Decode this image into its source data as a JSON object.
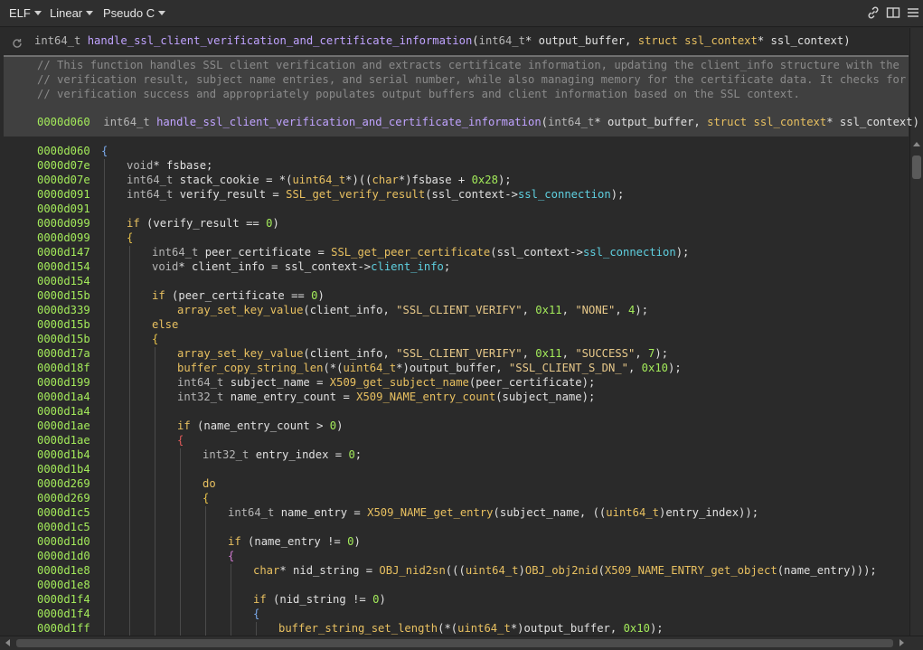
{
  "toolbar": {
    "view_menu": "ELF",
    "layout_menu": "Linear",
    "lang_menu": "Pseudo C",
    "icons": [
      "link-icon",
      "split-view-icon",
      "hamburger-menu-icon"
    ]
  },
  "header_signature": [
    {
      "t": "int64_t ",
      "c": "type"
    },
    {
      "t": "handle_ssl_client_verification_and_certificate_information",
      "c": "fn"
    },
    {
      "t": "(",
      "c": "var"
    },
    {
      "t": "int64_t",
      "c": "type"
    },
    {
      "t": "* output_buffer, ",
      "c": "var"
    },
    {
      "t": "struct ",
      "c": "kw"
    },
    {
      "t": "ssl_context",
      "c": "kw"
    },
    {
      "t": "* ssl_context)",
      "c": "var"
    }
  ],
  "comment_lines": [
    "// This function handles SSL client verification and extracts certificate information, updating the client_info structure with the",
    "// verification result, subject name entries, and serial number, while also managing memory for the certificate data. It checks for",
    "// verification success and appropriately populates output buffers and client information based on the SSL context."
  ],
  "comment_signature": [
    {
      "t": "0000d060  ",
      "c": "num"
    },
    {
      "t": "int64_t ",
      "c": "type"
    },
    {
      "t": "handle_ssl_client_verification_and_certificate_information",
      "c": "fn"
    },
    {
      "t": "(",
      "c": "var"
    },
    {
      "t": "int64_t",
      "c": "type"
    },
    {
      "t": "* output_buffer, ",
      "c": "var"
    },
    {
      "t": "struct ",
      "c": "kw"
    },
    {
      "t": "ssl_context",
      "c": "kw"
    },
    {
      "t": "* ssl_context)",
      "c": "var"
    }
  ],
  "code_lines": [
    {
      "addr": "0000d060",
      "indent": 0,
      "tokens": [
        {
          "t": "{",
          "c": "bl"
        }
      ]
    },
    {
      "addr": "0000d07e",
      "indent": 1,
      "tokens": [
        {
          "t": "void",
          "c": "type"
        },
        {
          "t": "* fsbase;",
          "c": "var"
        }
      ]
    },
    {
      "addr": "0000d07e",
      "indent": 1,
      "tokens": [
        {
          "t": "int64_t",
          "c": "type"
        },
        {
          "t": " stack_cookie = *(",
          "c": "var"
        },
        {
          "t": "uint64_t",
          "c": "kw"
        },
        {
          "t": "*)((",
          "c": "var"
        },
        {
          "t": "char",
          "c": "kw"
        },
        {
          "t": "*)fsbase + ",
          "c": "var"
        },
        {
          "t": "0x28",
          "c": "num"
        },
        {
          "t": ");",
          "c": "var"
        }
      ]
    },
    {
      "addr": "0000d091",
      "indent": 1,
      "tokens": [
        {
          "t": "int64_t",
          "c": "type"
        },
        {
          "t": " verify_result = ",
          "c": "var"
        },
        {
          "t": "SSL_get_verify_result",
          "c": "kw"
        },
        {
          "t": "(ssl_context->",
          "c": "var"
        },
        {
          "t": "ssl_connection",
          "c": "field"
        },
        {
          "t": ");",
          "c": "var"
        }
      ]
    },
    {
      "addr": "0000d091",
      "indent": 1,
      "tokens": []
    },
    {
      "addr": "0000d099",
      "indent": 1,
      "tokens": [
        {
          "t": "if",
          "c": "kw"
        },
        {
          "t": " (verify_result == ",
          "c": "var"
        },
        {
          "t": "0",
          "c": "num"
        },
        {
          "t": ")",
          "c": "var"
        }
      ]
    },
    {
      "addr": "0000d099",
      "indent": 1,
      "tokens": [
        {
          "t": "{",
          "c": "bo"
        }
      ]
    },
    {
      "addr": "0000d147",
      "indent": 2,
      "tokens": [
        {
          "t": "int64_t",
          "c": "type"
        },
        {
          "t": " peer_certificate = ",
          "c": "var"
        },
        {
          "t": "SSL_get_peer_certificate",
          "c": "kw"
        },
        {
          "t": "(ssl_context->",
          "c": "var"
        },
        {
          "t": "ssl_connection",
          "c": "field"
        },
        {
          "t": ");",
          "c": "var"
        }
      ]
    },
    {
      "addr": "0000d154",
      "indent": 2,
      "tokens": [
        {
          "t": "void",
          "c": "type"
        },
        {
          "t": "* client_info = ssl_context->",
          "c": "var"
        },
        {
          "t": "client_info",
          "c": "field"
        },
        {
          "t": ";",
          "c": "var"
        }
      ]
    },
    {
      "addr": "0000d154",
      "indent": 2,
      "tokens": []
    },
    {
      "addr": "0000d15b",
      "indent": 2,
      "tokens": [
        {
          "t": "if",
          "c": "kw"
        },
        {
          "t": " (peer_certificate == ",
          "c": "var"
        },
        {
          "t": "0",
          "c": "num"
        },
        {
          "t": ")",
          "c": "var"
        }
      ]
    },
    {
      "addr": "0000d339",
      "indent": 3,
      "tokens": [
        {
          "t": "array_set_key_value",
          "c": "kw"
        },
        {
          "t": "(client_info, ",
          "c": "var"
        },
        {
          "t": "\"SSL_CLIENT_VERIFY\"",
          "c": "str"
        },
        {
          "t": ", ",
          "c": "var"
        },
        {
          "t": "0x11",
          "c": "num"
        },
        {
          "t": ", ",
          "c": "var"
        },
        {
          "t": "\"NONE\"",
          "c": "str"
        },
        {
          "t": ", ",
          "c": "var"
        },
        {
          "t": "4",
          "c": "num"
        },
        {
          "t": ");",
          "c": "var"
        }
      ]
    },
    {
      "addr": "0000d15b",
      "indent": 2,
      "tokens": [
        {
          "t": "else",
          "c": "kw"
        }
      ]
    },
    {
      "addr": "0000d15b",
      "indent": 2,
      "tokens": [
        {
          "t": "{",
          "c": "bo"
        }
      ]
    },
    {
      "addr": "0000d17a",
      "indent": 3,
      "tokens": [
        {
          "t": "array_set_key_value",
          "c": "kw"
        },
        {
          "t": "(client_info, ",
          "c": "var"
        },
        {
          "t": "\"SSL_CLIENT_VERIFY\"",
          "c": "str"
        },
        {
          "t": ", ",
          "c": "var"
        },
        {
          "t": "0x11",
          "c": "num"
        },
        {
          "t": ", ",
          "c": "var"
        },
        {
          "t": "\"SUCCESS\"",
          "c": "str"
        },
        {
          "t": ", ",
          "c": "var"
        },
        {
          "t": "7",
          "c": "num"
        },
        {
          "t": ");",
          "c": "var"
        }
      ]
    },
    {
      "addr": "0000d18f",
      "indent": 3,
      "tokens": [
        {
          "t": "buffer_copy_string_len",
          "c": "kw"
        },
        {
          "t": "(*(",
          "c": "var"
        },
        {
          "t": "uint64_t",
          "c": "kw"
        },
        {
          "t": "*)output_buffer, ",
          "c": "var"
        },
        {
          "t": "\"SSL_CLIENT_S_DN_\"",
          "c": "str"
        },
        {
          "t": ", ",
          "c": "var"
        },
        {
          "t": "0x10",
          "c": "num"
        },
        {
          "t": ");",
          "c": "var"
        }
      ]
    },
    {
      "addr": "0000d199",
      "indent": 3,
      "tokens": [
        {
          "t": "int64_t",
          "c": "type"
        },
        {
          "t": " subject_name = ",
          "c": "var"
        },
        {
          "t": "X509_get_subject_name",
          "c": "kw"
        },
        {
          "t": "(peer_certificate);",
          "c": "var"
        }
      ]
    },
    {
      "addr": "0000d1a4",
      "indent": 3,
      "tokens": [
        {
          "t": "int32_t",
          "c": "type"
        },
        {
          "t": " name_entry_count = ",
          "c": "var"
        },
        {
          "t": "X509_NAME_entry_count",
          "c": "kw"
        },
        {
          "t": "(subject_name);",
          "c": "var"
        }
      ]
    },
    {
      "addr": "0000d1a4",
      "indent": 3,
      "tokens": []
    },
    {
      "addr": "0000d1ae",
      "indent": 3,
      "tokens": [
        {
          "t": "if",
          "c": "kw"
        },
        {
          "t": " (name_entry_count > ",
          "c": "var"
        },
        {
          "t": "0",
          "c": "num"
        },
        {
          "t": ")",
          "c": "var"
        }
      ]
    },
    {
      "addr": "0000d1ae",
      "indent": 3,
      "tokens": [
        {
          "t": "{",
          "c": "br"
        }
      ]
    },
    {
      "addr": "0000d1b4",
      "indent": 4,
      "tokens": [
        {
          "t": "int32_t",
          "c": "type"
        },
        {
          "t": " entry_index = ",
          "c": "var"
        },
        {
          "t": "0",
          "c": "num"
        },
        {
          "t": ";",
          "c": "var"
        }
      ]
    },
    {
      "addr": "0000d1b4",
      "indent": 4,
      "tokens": []
    },
    {
      "addr": "0000d269",
      "indent": 4,
      "tokens": [
        {
          "t": "do",
          "c": "kw"
        }
      ]
    },
    {
      "addr": "0000d269",
      "indent": 4,
      "tokens": [
        {
          "t": "{",
          "c": "bo"
        }
      ]
    },
    {
      "addr": "0000d1c5",
      "indent": 5,
      "tokens": [
        {
          "t": "int64_t",
          "c": "type"
        },
        {
          "t": " name_entry = ",
          "c": "var"
        },
        {
          "t": "X509_NAME_get_entry",
          "c": "kw"
        },
        {
          "t": "(subject_name, ((",
          "c": "var"
        },
        {
          "t": "uint64_t",
          "c": "kw"
        },
        {
          "t": ")entry_index));",
          "c": "var"
        }
      ]
    },
    {
      "addr": "0000d1c5",
      "indent": 5,
      "tokens": []
    },
    {
      "addr": "0000d1d0",
      "indent": 5,
      "tokens": [
        {
          "t": "if",
          "c": "kw"
        },
        {
          "t": " (name_entry != ",
          "c": "var"
        },
        {
          "t": "0",
          "c": "num"
        },
        {
          "t": ")",
          "c": "var"
        }
      ]
    },
    {
      "addr": "0000d1d0",
      "indent": 5,
      "tokens": [
        {
          "t": "{",
          "c": "bp"
        }
      ]
    },
    {
      "addr": "0000d1e8",
      "indent": 6,
      "tokens": [
        {
          "t": "char",
          "c": "kw"
        },
        {
          "t": "* nid_string = ",
          "c": "var"
        },
        {
          "t": "OBJ_nid2sn",
          "c": "kw"
        },
        {
          "t": "(((",
          "c": "var"
        },
        {
          "t": "uint64_t",
          "c": "kw"
        },
        {
          "t": ")",
          "c": "var"
        },
        {
          "t": "OBJ_obj2nid",
          "c": "kw"
        },
        {
          "t": "(",
          "c": "var"
        },
        {
          "t": "X509_NAME_ENTRY_get_object",
          "c": "kw"
        },
        {
          "t": "(name_entry)));",
          "c": "var"
        }
      ]
    },
    {
      "addr": "0000d1e8",
      "indent": 6,
      "tokens": []
    },
    {
      "addr": "0000d1f4",
      "indent": 6,
      "tokens": [
        {
          "t": "if",
          "c": "kw"
        },
        {
          "t": " (nid_string != ",
          "c": "var"
        },
        {
          "t": "0",
          "c": "num"
        },
        {
          "t": ")",
          "c": "var"
        }
      ]
    },
    {
      "addr": "0000d1f4",
      "indent": 6,
      "tokens": [
        {
          "t": "{",
          "c": "bl"
        }
      ]
    },
    {
      "addr": "0000d1ff",
      "indent": 7,
      "tokens": [
        {
          "t": "buffer_string_set_length",
          "c": "kw"
        },
        {
          "t": "(*(",
          "c": "var"
        },
        {
          "t": "uint64_t",
          "c": "kw"
        },
        {
          "t": "*)output_buffer, ",
          "c": "var"
        },
        {
          "t": "0x10",
          "c": "num"
        },
        {
          "t": ");",
          "c": "var"
        }
      ]
    }
  ]
}
